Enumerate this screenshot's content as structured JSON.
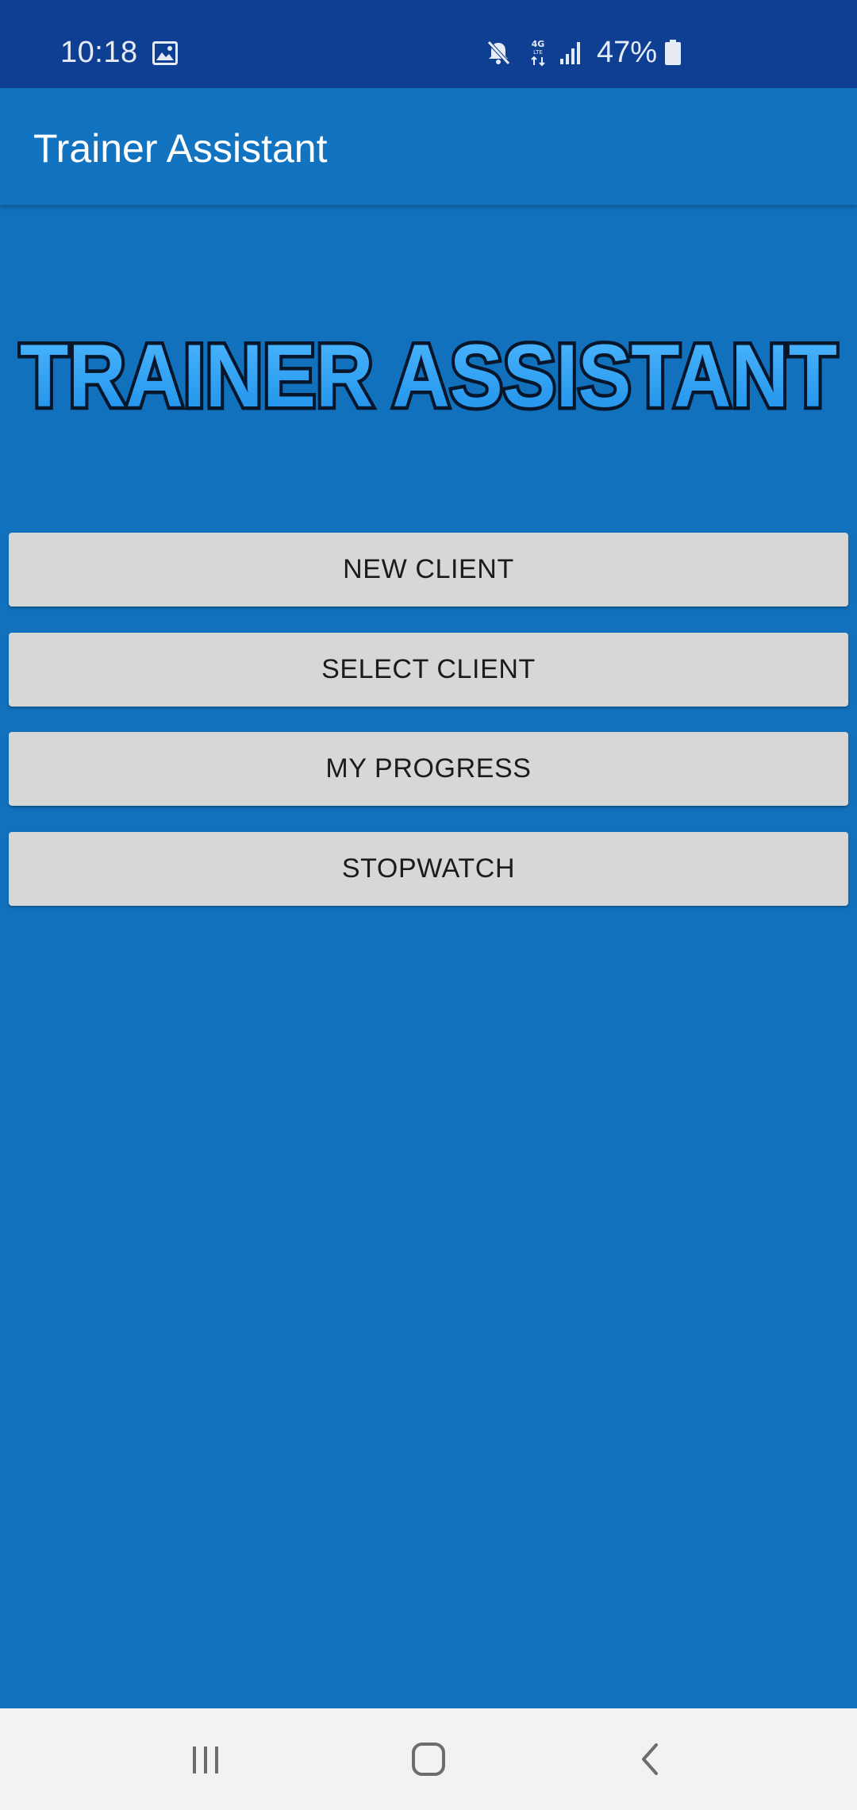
{
  "status_bar": {
    "time": "10:18",
    "battery": "47%",
    "icons": [
      "gallery-icon",
      "mute-icon",
      "lte-4g-icon",
      "signal-icon",
      "battery-icon"
    ]
  },
  "app_bar": {
    "title": "Trainer Assistant"
  },
  "logo": {
    "text": "TRAINER ASSISTANT"
  },
  "menu": {
    "new_client": "NEW CLIENT",
    "select_client": "SELECT CLIENT",
    "my_progress": "MY PROGRESS",
    "stopwatch": "STOPWATCH"
  },
  "nav_bar": {
    "icons": [
      "recents-icon",
      "home-icon",
      "back-icon"
    ]
  },
  "colors": {
    "status_bar": "#0f3f93",
    "app_bar": "#1273c0",
    "background": "#1171bd",
    "button": "#d6d7d7",
    "logo_fill": "#2a9df4"
  }
}
